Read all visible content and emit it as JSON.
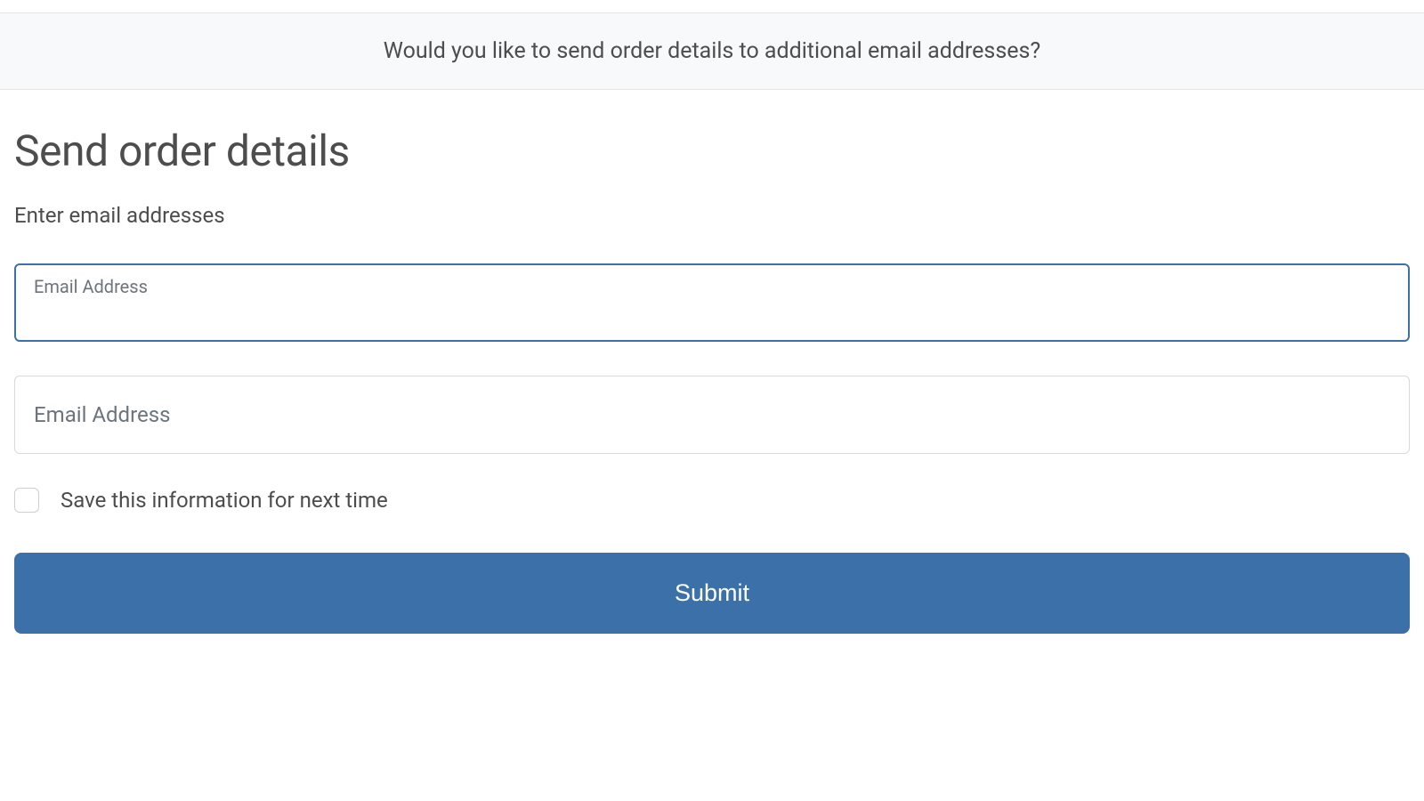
{
  "banner": {
    "text": "Would you like to send order details to additional email addresses?"
  },
  "form": {
    "heading": "Send order details",
    "sublabel": "Enter email addresses",
    "email1": {
      "label": "Email Address",
      "value": ""
    },
    "email2": {
      "label": "Email Address",
      "value": ""
    },
    "save_checkbox_label": "Save this information for next time",
    "submit_label": "Submit"
  }
}
